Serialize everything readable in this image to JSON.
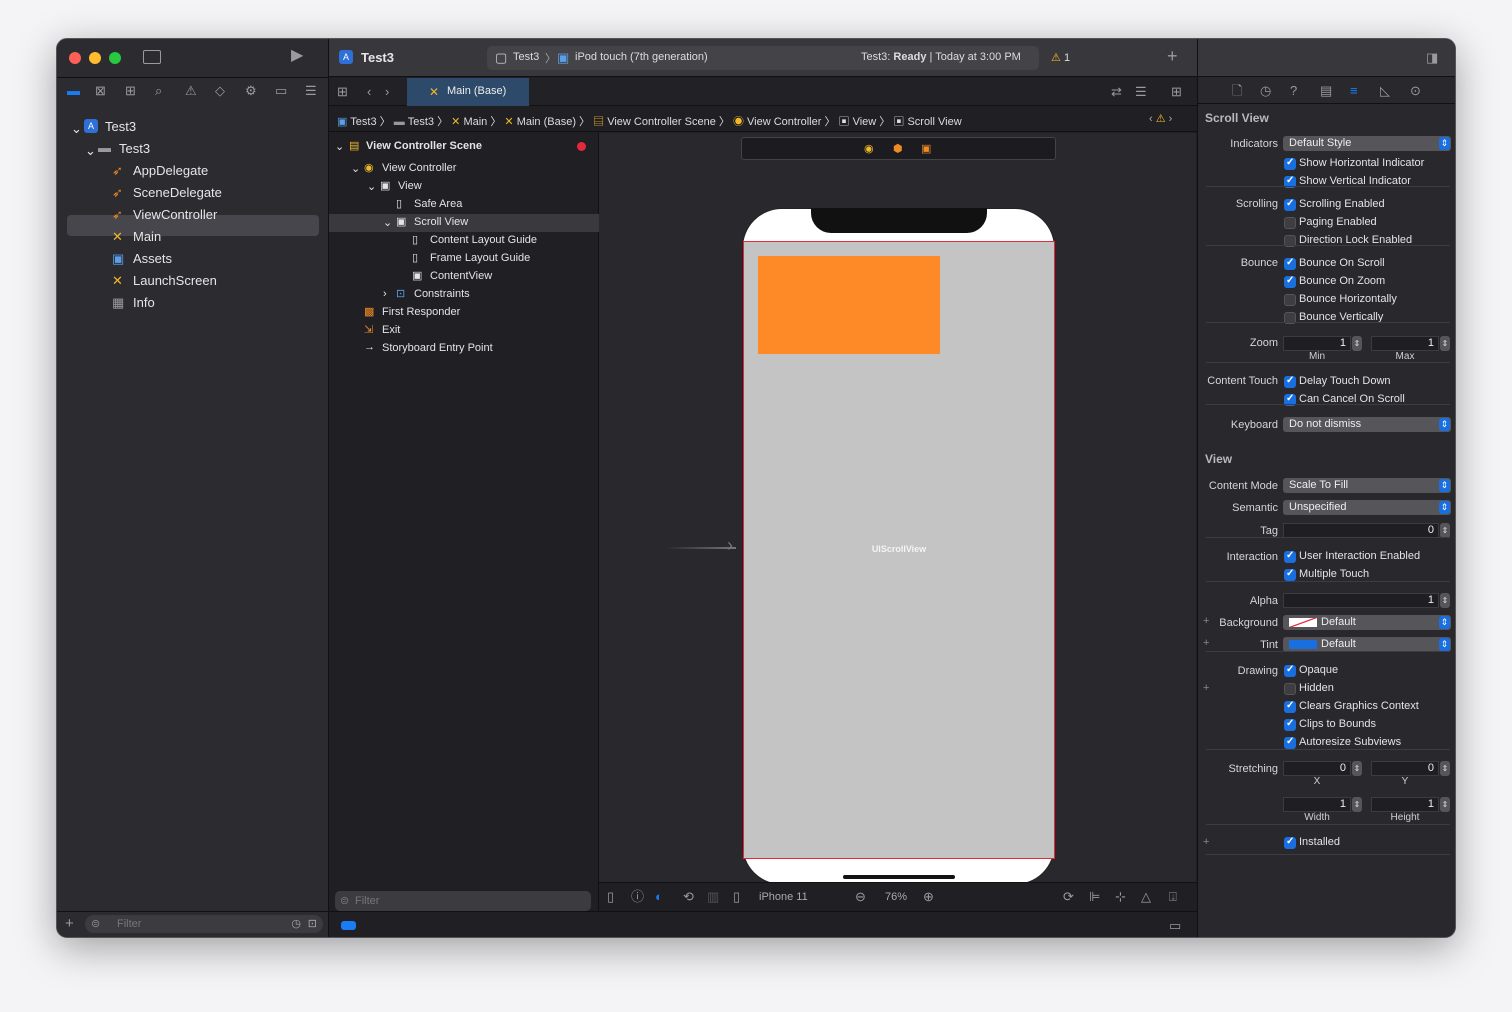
{
  "window": {
    "project": "Test3",
    "scheme": "Test3",
    "device": "iPod touch (7th generation)",
    "status_prefix": "Test3:",
    "status_state": "Ready",
    "status_time": "Today at 3:00 PM",
    "warning_count": "1"
  },
  "navigator": {
    "tree": [
      {
        "label": "Test3"
      },
      {
        "label": "Test3"
      },
      {
        "label": "AppDelegate"
      },
      {
        "label": "SceneDelegate"
      },
      {
        "label": "ViewController"
      },
      {
        "label": "Main"
      },
      {
        "label": "Assets"
      },
      {
        "label": "LaunchScreen"
      },
      {
        "label": "Info"
      }
    ],
    "filter_placeholder": "Filter"
  },
  "editor": {
    "tab": "Main (Base)",
    "breadcrumb": [
      "Test3",
      "Test3",
      "Main",
      "Main (Base)",
      "View Controller Scene",
      "View Controller",
      "View",
      "Scroll View"
    ]
  },
  "outline": {
    "items": [
      "View Controller Scene",
      "View Controller",
      "View",
      "Safe Area",
      "Scroll View",
      "Content Layout Guide",
      "Frame Layout Guide",
      "ContentView",
      "Constraints",
      "First Responder",
      "Exit",
      "Storyboard Entry Point"
    ],
    "filter_placeholder": "Filter"
  },
  "canvas": {
    "view_label": "UIScrollView",
    "device": "iPhone 11",
    "zoom": "76%",
    "colors": {
      "scroll_bg": "#c4c4c4",
      "orange_view": "#fd8a27",
      "selection": "#e5283c"
    }
  },
  "inspector": {
    "scroll_title": "Scroll View",
    "indicators_label": "Indicators",
    "indicators_value": "Default Style",
    "show_h": {
      "label": "Show Horizontal Indicator",
      "checked": true
    },
    "show_v": {
      "label": "Show Vertical Indicator",
      "checked": true
    },
    "scrolling_label": "Scrolling",
    "scroll_enabled": {
      "label": "Scrolling Enabled",
      "checked": true
    },
    "paging": {
      "label": "Paging Enabled",
      "checked": false
    },
    "dir_lock": {
      "label": "Direction Lock Enabled",
      "checked": false
    },
    "bounce_label": "Bounce",
    "bounce_scroll": {
      "label": "Bounce On Scroll",
      "checked": true
    },
    "bounce_zoom": {
      "label": "Bounce On Zoom",
      "checked": true
    },
    "bounce_h": {
      "label": "Bounce Horizontally",
      "checked": false
    },
    "bounce_v": {
      "label": "Bounce Vertically",
      "checked": false
    },
    "zoom_label": "Zoom",
    "zoom_min": "1",
    "zoom_max": "1",
    "min_label": "Min",
    "max_label": "Max",
    "content_touch_label": "Content Touch",
    "delay_touch": {
      "label": "Delay Touch Down",
      "checked": true
    },
    "cancel_scroll": {
      "label": "Can Cancel On Scroll",
      "checked": true
    },
    "keyboard_label": "Keyboard",
    "keyboard_value": "Do not dismiss",
    "view_title": "View",
    "content_mode_label": "Content Mode",
    "content_mode_value": "Scale To Fill",
    "semantic_label": "Semantic",
    "semantic_value": "Unspecified",
    "tag_label": "Tag",
    "tag_value": "0",
    "interaction_label": "Interaction",
    "user_interaction": {
      "label": "User Interaction Enabled",
      "checked": true
    },
    "multi_touch": {
      "label": "Multiple Touch",
      "checked": true
    },
    "alpha_label": "Alpha",
    "alpha_value": "1",
    "background_label": "Background",
    "background_value": "Default",
    "tint_label": "Tint",
    "tint_value": "Default",
    "tint_color": "#1a6fe0",
    "drawing_label": "Drawing",
    "opaque": {
      "label": "Opaque",
      "checked": true
    },
    "hidden": {
      "label": "Hidden",
      "checked": false
    },
    "clears": {
      "label": "Clears Graphics Context",
      "checked": true
    },
    "clips": {
      "label": "Clips to Bounds",
      "checked": true
    },
    "autoresize": {
      "label": "Autoresize Subviews",
      "checked": true
    },
    "stretching_label": "Stretching",
    "stretch_x": "0",
    "stretch_y": "0",
    "stretch_w": "1",
    "stretch_h": "1",
    "x_label": "X",
    "y_label": "Y",
    "width_label": "Width",
    "height_label": "Height",
    "installed": {
      "label": "Installed",
      "checked": true
    }
  }
}
